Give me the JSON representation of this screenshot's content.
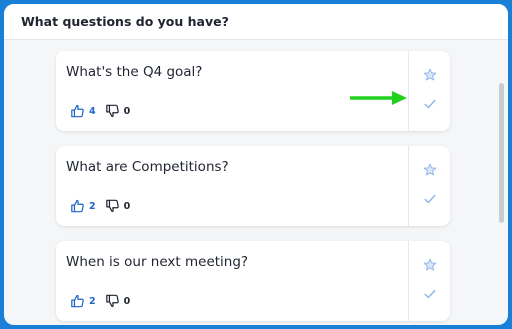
{
  "panel": {
    "title": "What questions do you have?"
  },
  "questions": [
    {
      "text": "What's the Q4 goal?",
      "upvotes": "4",
      "downvotes": "0"
    },
    {
      "text": "What are Competitions?",
      "upvotes": "2",
      "downvotes": "0"
    },
    {
      "text": "When is our next meeting?",
      "upvotes": "2",
      "downvotes": "0"
    }
  ],
  "icons": {
    "upvote": "thumbs-up-icon",
    "downvote": "thumbs-down-icon",
    "favorite": "star-icon",
    "answered": "check-icon",
    "annotation": "arrow-right-icon"
  },
  "colors": {
    "frame": "#1a7fd6",
    "upvote": "#1f66c9",
    "side_icons": "#8fb6e6",
    "annotation_arrow": "#22d11e"
  }
}
